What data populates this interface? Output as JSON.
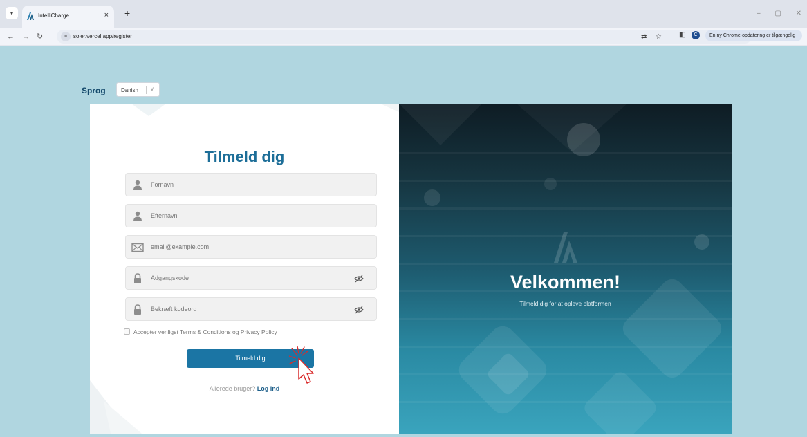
{
  "browser": {
    "tab_title": "IntelliCharge",
    "tab_close": "×",
    "new_tab": "+",
    "url": "soler.vercel.app/register",
    "update_text": "En ny Chrome-opdatering er tilgængelig",
    "profile_initial": "C",
    "win_min": "–",
    "win_max": "▢",
    "win_close": "✕"
  },
  "language": {
    "label": "Sprog",
    "value": "Danish"
  },
  "form": {
    "title": "Tilmeld dig",
    "first_name_placeholder": "Fornavn",
    "last_name_placeholder": "Efternavn",
    "email_placeholder": "email@example.com",
    "password_placeholder": "Adgangskode",
    "confirm_password_placeholder": "Bekræft kodeord",
    "terms_text": "Accepter venligst Terms & Conditions og Privacy Policy",
    "terms_checked": false,
    "submit_label": "Tilmeld dig",
    "login_prompt": "Allerede bruger?",
    "login_link": "Log ind"
  },
  "welcome": {
    "title": "Velkommen!",
    "subtitle": "Tilmeld dig for at opleve platformen"
  },
  "colors": {
    "page_bg": "#b0d6e0",
    "accent": "#1b75a4",
    "title": "#1d6e98",
    "link": "#1d5f8a",
    "cursor": "#d92b2b"
  },
  "icons": [
    "favicon-icon",
    "back-icon",
    "forward-icon",
    "reload-icon",
    "site-settings-icon",
    "translate-icon",
    "bookmark-star-icon",
    "side-panel-icon",
    "user-icon",
    "mail-icon",
    "lock-icon",
    "eye-off-icon",
    "cursor-click-icon",
    "brand-logo-icon"
  ]
}
